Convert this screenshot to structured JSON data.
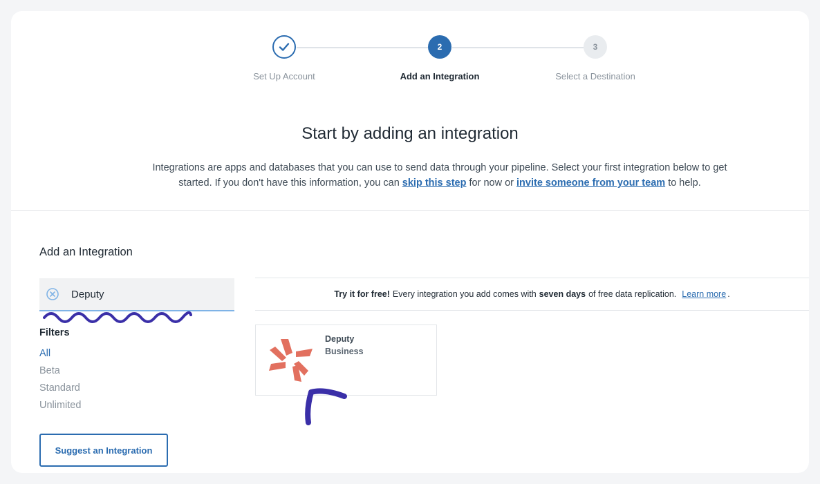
{
  "stepper": {
    "steps": [
      {
        "label": "Set Up Account",
        "state": "done"
      },
      {
        "label": "Add an Integration",
        "number": "2",
        "state": "active"
      },
      {
        "label": "Select a Destination",
        "number": "3",
        "state": "todo"
      }
    ]
  },
  "intro": {
    "headline": "Start by adding an integration",
    "text_1": "Integrations are apps and databases that you can use to send data through your pipeline. Select your first integration below to get started. If you don't have this information, you can",
    "link_skip": "skip this step",
    "text_2": "for now or",
    "link_invite": "invite someone from your team",
    "text_3": "to help."
  },
  "sidebar": {
    "title": "Add an Integration",
    "search_value": "Deputy",
    "filters_title": "Filters",
    "filters": [
      "All",
      "Beta",
      "Standard",
      "Unlimited"
    ],
    "suggest_label": "Suggest an Integration"
  },
  "banner": {
    "bold_1": "Try it for free!",
    "text_1": "Every integration you add comes with",
    "bold_2": "seven days",
    "text_2": "of free data replication.",
    "link": "Learn more",
    "end": "."
  },
  "results": [
    {
      "name": "Deputy",
      "tier": "Business",
      "icon": "deputy-logo"
    }
  ],
  "colors": {
    "accent": "#2b6cb0",
    "deputy_brand": "#e2705f",
    "annotation": "#3a2fa8"
  }
}
